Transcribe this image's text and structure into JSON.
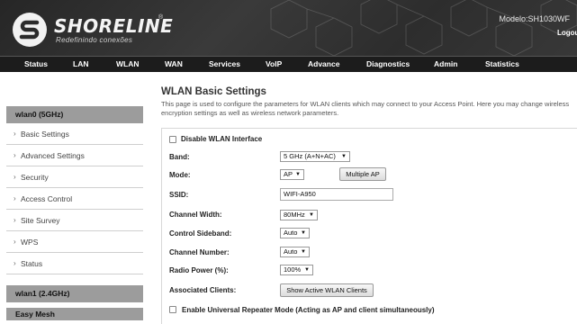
{
  "header": {
    "brand": "SHORELINE",
    "registered": "®",
    "tagline": "Redefinindo conexões",
    "model": "Modelo:SH1030WF",
    "logout": "Logout"
  },
  "nav": {
    "items": [
      "Status",
      "LAN",
      "WLAN",
      "WAN",
      "Services",
      "VoIP",
      "Advance",
      "Diagnostics",
      "Admin",
      "Statistics"
    ]
  },
  "sidebar": {
    "group1": "wlan0 (5GHz)",
    "items": [
      "Basic Settings",
      "Advanced Settings",
      "Security",
      "Access Control",
      "Site Survey",
      "WPS",
      "Status"
    ],
    "group2": "wlan1 (2.4GHz)",
    "group3": "Easy Mesh"
  },
  "main": {
    "title": "WLAN Basic Settings",
    "description": "This page is used to configure the parameters for WLAN clients which may connect to your Access Point. Here you may change wireless encryption settings as well as wireless network parameters.",
    "disable_label": "Disable WLAN Interface",
    "band_label": "Band:",
    "band_value": "5 GHz (A+N+AC)",
    "mode_label": "Mode:",
    "mode_value": "AP",
    "multiple_ap": "Multiple AP",
    "ssid_label": "SSID:",
    "ssid_value": "WIFI-A950",
    "channel_width_label": "Channel Width:",
    "channel_width_value": "80MHz",
    "control_sideband_label": "Control Sideband:",
    "control_sideband_value": "Auto",
    "channel_number_label": "Channel Number:",
    "channel_number_value": "Auto",
    "radio_power_label": "Radio Power (%):",
    "radio_power_value": "100%",
    "associated_label": "Associated Clients:",
    "show_clients": "Show Active WLAN Clients",
    "repeater_label": "Enable Universal Repeater Mode (Acting as AP and client simultaneously)"
  },
  "glyphs": {
    "chevron": "›",
    "dropdown": "▼"
  }
}
